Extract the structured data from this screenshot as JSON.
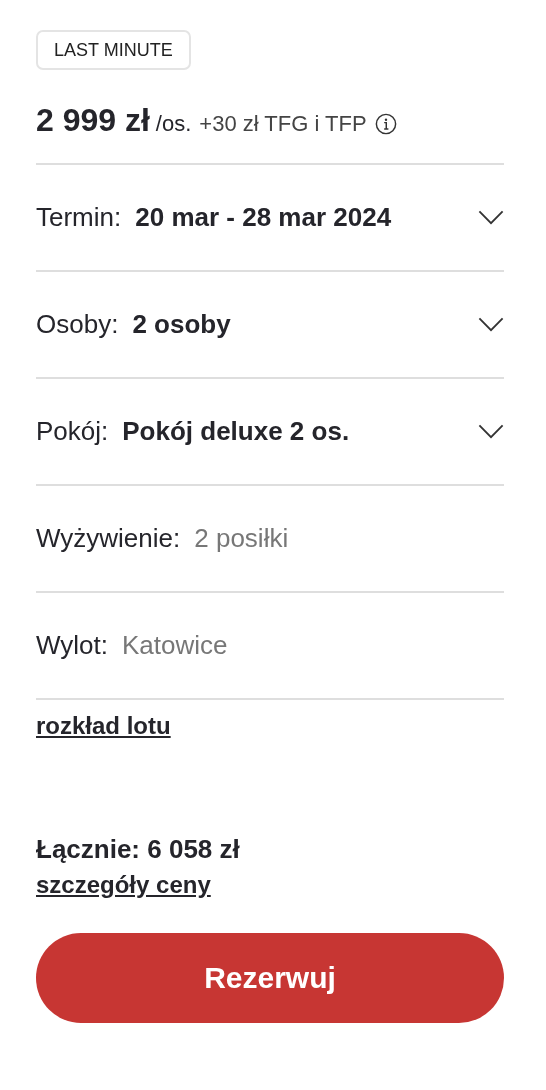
{
  "badge": "LAST MINUTE",
  "price": {
    "amount": "2 999 zł",
    "unit": "/os.",
    "extra": "+30 zł TFG i TFP"
  },
  "options": [
    {
      "kind": "select",
      "label": "Termin:",
      "value": "20 mar - 28 mar 2024"
    },
    {
      "kind": "select",
      "label": "Osoby:",
      "value": "2 osoby"
    },
    {
      "kind": "select",
      "label": "Pokój:",
      "value": "Pokój deluxe 2 os."
    },
    {
      "kind": "fixed",
      "label": "Wyżywienie:",
      "value": "2 posiłki"
    },
    {
      "kind": "fixed",
      "label": "Wylot:",
      "value": "Katowice"
    }
  ],
  "flight_link": "rozkład lotu",
  "total": "Łącznie: 6 058 zł",
  "price_details_link": "szczegóły ceny",
  "book_button": "Rezerwuj"
}
